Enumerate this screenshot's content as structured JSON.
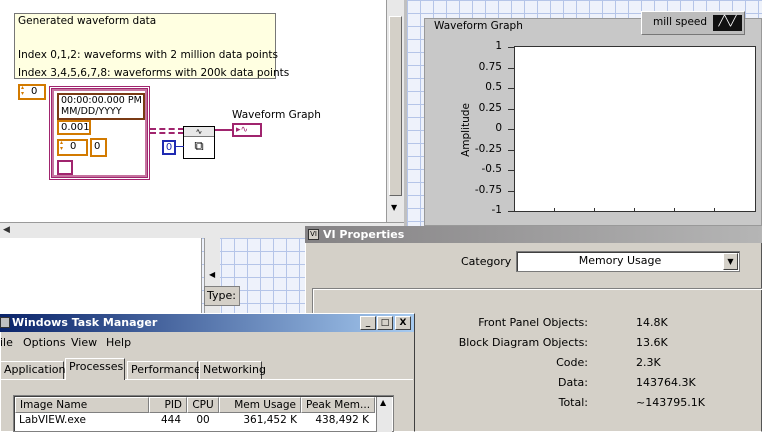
{
  "block_diagram": {
    "comment_lines": [
      "Generated waveform data",
      "Index 0,1,2: waveforms with 2 million data points",
      "Index 3,4,5,6,7,8: waveforms with 200k data points"
    ],
    "array_index": "0",
    "cluster": {
      "timestamp_line1": "00:00:00.000 PM",
      "timestamp_line2": "MM/DD/YYYY",
      "dt": "0.001",
      "y_index": "0",
      "y_value": "0"
    },
    "index_constant": "0",
    "terminal_label": "Waveform Graph"
  },
  "front_panel": {
    "graph": {
      "title": "Waveform Graph",
      "legend_name": "mill speed"
    }
  },
  "chart_data": {
    "type": "line",
    "title": "Waveform Graph",
    "xlabel": "",
    "ylabel": "Amplitude",
    "ylim": [
      -1,
      1
    ],
    "y_ticks": [
      "1",
      "0.75",
      "0.5",
      "0.25",
      "0",
      "-0.25",
      "-0.5",
      "-0.75",
      "-1"
    ],
    "legend": "top-right",
    "series": [
      {
        "name": "mill speed",
        "values": []
      }
    ]
  },
  "vi_properties": {
    "title": "VI Properties",
    "category_label": "Category",
    "category_value": "Memory Usage",
    "rows": [
      {
        "label": "Front Panel Objects:",
        "value": "14.8K"
      },
      {
        "label": "Block Diagram Objects:",
        "value": "13.6K"
      },
      {
        "label": "Code:",
        "value": "2.3K"
      },
      {
        "label": "Data:",
        "value": "143764.3K"
      },
      {
        "label": "Total:",
        "value": "~143795.1K"
      }
    ]
  },
  "context_help": {
    "type_label": "Type:"
  },
  "task_manager": {
    "title": "Windows Task Manager",
    "menu": [
      "ile",
      "Options",
      "View",
      "Help"
    ],
    "tabs": [
      "Applications",
      "Processes",
      "Performance",
      "Networking"
    ],
    "columns": [
      "Image Name",
      "PID",
      "CPU",
      "Mem Usage",
      "Peak Mem..."
    ],
    "rows": [
      {
        "name": "LabVIEW.exe",
        "pid": "444",
        "cpu": "00",
        "mem": "361,452 K",
        "peak": "438,492 K"
      }
    ],
    "window_buttons": [
      "_",
      "□",
      "X"
    ]
  }
}
